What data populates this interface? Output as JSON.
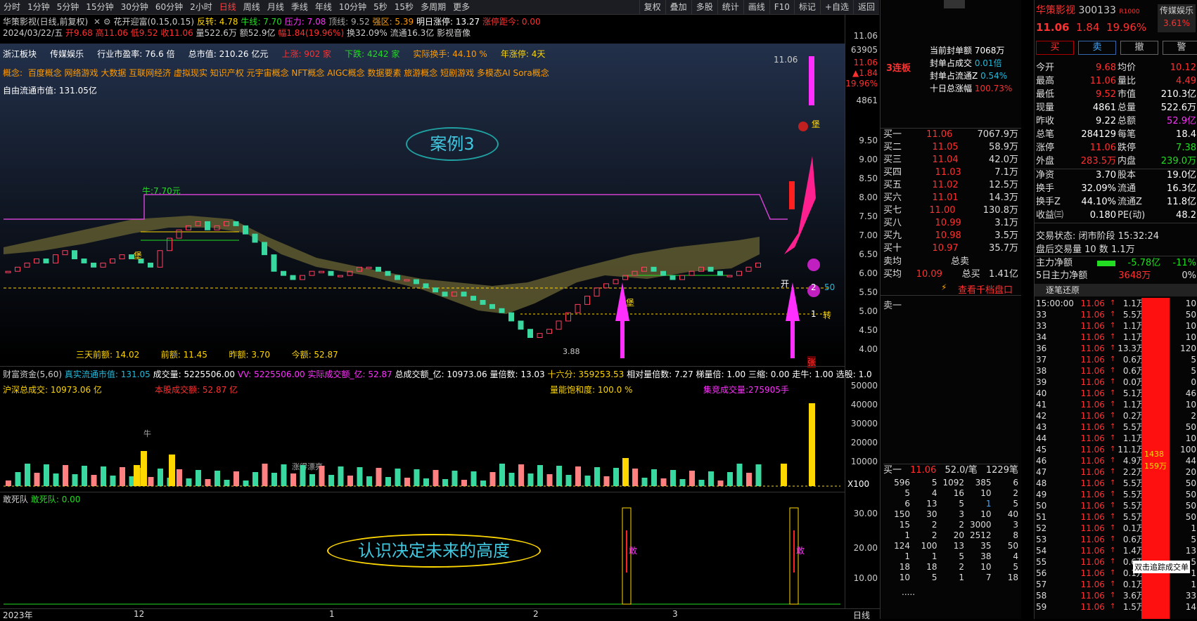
{
  "toolbar": {
    "tabs": [
      "分时",
      "1分钟",
      "5分钟",
      "15分钟",
      "30分钟",
      "60分钟",
      "2小时",
      "日线",
      "周线",
      "月线",
      "季线",
      "年线",
      "10分钟",
      "5秒",
      "15秒",
      "多周期",
      "更多"
    ],
    "active_tab": "日线",
    "right_tabs": [
      "复权",
      "叠加",
      "多股",
      "统计",
      "画线",
      "F10",
      "标记",
      "+自选",
      "返回"
    ]
  },
  "header": {
    "line1": {
      "name": "华策影视(日线,前复权)",
      "indicator": "花开迎富(0.15,0.15)",
      "fanzhuan": "反转: 4.78",
      "niuxian": "牛线: 7.70",
      "yali": "压力: 7.08",
      "dingxian": "顶线: 9.52",
      "qiangqu": "强区: 5.39",
      "mingri": "明日涨停: 13.27",
      "juli": "涨停距今: 0.00"
    },
    "line2": {
      "date": "2024/03/22/五",
      "kai": "开9.68",
      "gao": "高11.06",
      "di": "低9.52",
      "shou": "收11.06",
      "liang": "量522.6万",
      "e": "额52.9亿",
      "fu": "幅1.84(19.96%)",
      "huan": "换32.09%",
      "liutong": "流通16.3亿",
      "industry": "影视音像"
    }
  },
  "info": {
    "sector": "浙江板块",
    "industry": "传媒娱乐",
    "pe_label": "行业市盈率:",
    "pe": "76.6 倍",
    "mv_label": "总市值:",
    "mv": "210.26 亿元",
    "up": "上涨: 902 家",
    "down": "下跌: 4242 家",
    "turnover": "实际换手: 44.10 %",
    "streak": "年涨停: 4天",
    "concepts_label": "概念:",
    "concepts": "百度概念 网络游戏 大数据 互联网经济 虚拟现实 知识产权 元宇宙概念 NFT概念 AIGC概念 数据要素 旅游概念 短剧游戏 多模态AI Sora概念",
    "float_mv": "自由流通市值: 131.05亿"
  },
  "annotations": {
    "case": "案例3",
    "niu": "牛:7.70元",
    "lastprice": "11.06",
    "low": "3.88",
    "bottom_text": "认识决定未来的高度",
    "kai": "开",
    "zhuan": "转",
    "b2": "2",
    "b1": "1",
    "v50": "50",
    "bao1": "堡",
    "bao2": "堡",
    "bao3": "堡",
    "zhang": "张"
  },
  "amounts": {
    "three": "三天前额: 14.02",
    "prev": "前额: 11.45",
    "yest": "昨额: 3.70",
    "today": "今额: 52.87"
  },
  "indicator1": {
    "title": "财富资金(5,60)",
    "float": "真实流通市值: 131.05",
    "vol": "成交量: 5225506.00",
    "vv": "VV: 5225506.00",
    "real_amt": "实际成交额_亿: 52.87",
    "total_amt": "总成交额_亿: 10973.06",
    "ratio": "量倍数: 13.03",
    "sixteen": "十六分: 359253.53",
    "rel": "相对量倍数: 7.27",
    "ti": "梯量倍: 1.00",
    "three": "三缩: 0.00",
    "walk": "走牛: 1.00",
    "pick": "选股: 1.0",
    "hs": "沪深总成交: 10973.06 亿",
    "stock": "本股成交额: 52.87 亿",
    "sat": "量能饱和度: 100.0 %",
    "auction": "集竞成交量:275905手",
    "niu": "牛",
    "piaoliang": "涨得漂亮",
    "x100": "X100"
  },
  "indicator2": {
    "title": "敢死队",
    "val": "敢死队: 0.00",
    "gan": "敢"
  },
  "yaxis": {
    "main": [
      "11.06",
      "63905",
      "11.06",
      "▲1.84",
      "19.96%",
      "4861",
      "9.50",
      "9.00",
      "8.50",
      "8.00",
      "7.50",
      "7.00",
      "6.50",
      "6.00",
      "5.50",
      "5.00",
      "4.50",
      "4.00"
    ],
    "vol": [
      "50000",
      "40000",
      "30000",
      "20000",
      "10000"
    ],
    "gan": [
      "30.00",
      "20.00",
      "10.00"
    ]
  },
  "xaxis": [
    "2023年",
    "12",
    "1",
    "2",
    "3"
  ],
  "xaxis_right": "日线",
  "quote": {
    "title": "3连板",
    "seal_label": "当前封单额",
    "seal": "7068万",
    "seal_ratio_label": "封单占成交",
    "seal_ratio": "0.01倍",
    "float_ratio_label": "封单占流通Z",
    "float_ratio": "0.54%",
    "ten_label": "十日总涨幅",
    "ten": "100.73%",
    "bids": [
      [
        "买一",
        "11.06",
        "7067.9万"
      ],
      [
        "买二",
        "11.05",
        "58.9万"
      ],
      [
        "买三",
        "11.04",
        "42.0万"
      ],
      [
        "买四",
        "11.03",
        "7.1万"
      ],
      [
        "买五",
        "11.02",
        "12.5万"
      ],
      [
        "买六",
        "11.01",
        "14.3万"
      ],
      [
        "买七",
        "11.00",
        "130.8万"
      ],
      [
        "买八",
        "10.99",
        "3.1万"
      ],
      [
        "买九",
        "10.98",
        "3.5万"
      ],
      [
        "买十",
        "10.97",
        "35.7万"
      ]
    ],
    "sell_avg": "卖均",
    "total_sell": "总卖",
    "buy_avg": "买均",
    "buy_avg_val": "10.09",
    "total_buy": "总买",
    "total_buy_val": "1.41亿",
    "view_all": "查看千档盘口",
    "sell1": "卖一",
    "buy1": {
      "label": "买一",
      "price": "11.06",
      "per": "52.0/笔",
      "count": "1229笔"
    },
    "queue": [
      [
        "596",
        "5",
        "1092",
        "385",
        "6"
      ],
      [
        "5",
        "4",
        "16",
        "10",
        "2"
      ],
      [
        "6",
        "13",
        "5",
        "1",
        "5"
      ],
      [
        "150",
        "30",
        "3",
        "10",
        "40"
      ],
      [
        "15",
        "2",
        "2",
        "3000",
        "3"
      ],
      [
        "1",
        "2",
        "20",
        "2512",
        "8"
      ],
      [
        "124",
        "100",
        "13",
        "35",
        "50"
      ],
      [
        "1",
        "1",
        "5",
        "38",
        "4"
      ],
      [
        "18",
        "18",
        "2",
        "10",
        "5"
      ],
      [
        "10",
        "5",
        "1",
        "7",
        "18"
      ]
    ],
    "more": "....."
  },
  "stock": {
    "name": "华策影视",
    "code": "300133",
    "tag": "R1000",
    "badge": "传媒娱乐",
    "badge_pct": "3.61%",
    "price": "11.06",
    "chg": "1.84",
    "pct": "19.96%",
    "buttons": [
      "买",
      "卖",
      "撤",
      "警"
    ],
    "stats": [
      [
        "今开",
        "9.68",
        "均价",
        "10.12"
      ],
      [
        "最高",
        "11.06",
        "量比",
        "4.49"
      ],
      [
        "最低",
        "9.52",
        "市值",
        "210.3亿"
      ],
      [
        "现量",
        "4861",
        "总量",
        "522.6万"
      ],
      [
        "昨收",
        "9.22",
        "总额",
        "52.9亿"
      ],
      [
        "总笔",
        "284129",
        "每笔",
        "18.4"
      ],
      [
        "涨停",
        "11.06",
        "跌停",
        "7.38"
      ],
      [
        "外盘",
        "283.5万",
        "内盘",
        "239.0万"
      ],
      [
        "净资",
        "3.70",
        "股本",
        "19.0亿"
      ],
      [
        "换手",
        "32.09%",
        "流通",
        "16.3亿"
      ],
      [
        "换手Z",
        "44.10%",
        "流通Z",
        "11.8亿"
      ],
      [
        "收益㈢",
        "0.180",
        "PE(动)",
        "48.2"
      ]
    ],
    "trade_state": "交易状态: 闭市阶段 15:32:24",
    "after": "盘后交易量 10 数 1.1万",
    "main_flow": "主力净额",
    "main_flow_val": "-5.78亿",
    "main_flow_pct": "-11%",
    "five_flow": "5日主力净额",
    "five_flow_val": "3648万",
    "five_flow_pct": "0%",
    "ticks_title": "逐笔还原",
    "ticks": [
      [
        "15:00:00",
        "11.06",
        "1.1万",
        "10"
      ],
      [
        "33",
        "11.06",
        "5.5万",
        "50"
      ],
      [
        "33",
        "11.06",
        "1.1万",
        "10"
      ],
      [
        "34",
        "11.06",
        "1.1万",
        "10"
      ],
      [
        "36",
        "11.06",
        "13.3万",
        "120"
      ],
      [
        "37",
        "11.06",
        "0.6万",
        "5"
      ],
      [
        "38",
        "11.06",
        "0.6万",
        "5"
      ],
      [
        "39",
        "11.06",
        "0.0万",
        "0"
      ],
      [
        "40",
        "11.06",
        "5.1万",
        "46"
      ],
      [
        "41",
        "11.06",
        "1.1万",
        "10"
      ],
      [
        "42",
        "11.06",
        "0.2万",
        "2"
      ],
      [
        "43",
        "11.06",
        "5.5万",
        "50"
      ],
      [
        "44",
        "11.06",
        "1.1万",
        "10"
      ],
      [
        "45",
        "11.06",
        "11.1万",
        "100"
      ],
      [
        "46",
        "11.06",
        "4.9万",
        "44"
      ],
      [
        "47",
        "11.06",
        "2.2万",
        "20"
      ],
      [
        "48",
        "11.06",
        "5.5万",
        "50"
      ],
      [
        "49",
        "11.06",
        "5.5万",
        "50"
      ],
      [
        "50",
        "11.06",
        "5.5万",
        "50"
      ],
      [
        "51",
        "11.06",
        "5.5万",
        "50"
      ],
      [
        "52",
        "11.06",
        "0.1万",
        "1"
      ],
      [
        "53",
        "11.06",
        "0.6万",
        "5"
      ],
      [
        "54",
        "11.06",
        "1.4万",
        "13"
      ],
      [
        "55",
        "11.06",
        "0.6万",
        "5"
      ],
      [
        "56",
        "11.06",
        "0.1万",
        "1"
      ],
      [
        "57",
        "11.06",
        "0.1万",
        "1"
      ],
      [
        "58",
        "11.06",
        "3.6万",
        "33"
      ],
      [
        "59",
        "11.06",
        "1.5万",
        "14"
      ]
    ],
    "bar_text1": "1438",
    "bar_text2": "159万",
    "tooltip": "双击追踪成交单"
  }
}
